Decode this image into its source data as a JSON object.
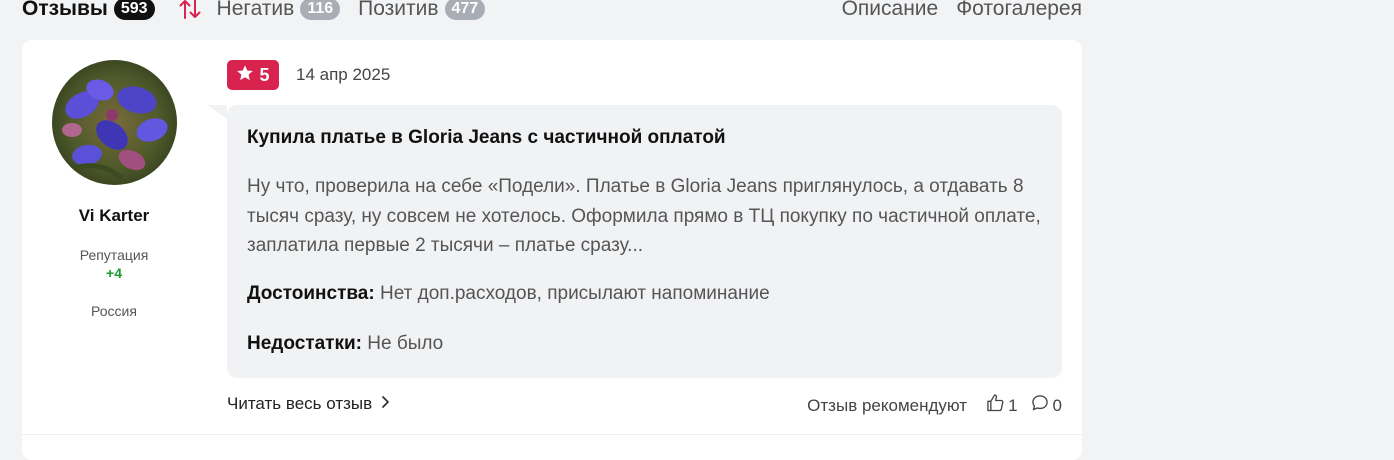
{
  "tabs": {
    "reviews": {
      "label": "Отзывы",
      "count": "593"
    },
    "negative": {
      "label": "Негатив",
      "count": "116"
    },
    "positive": {
      "label": "Позитив",
      "count": "477"
    },
    "description": "Описание",
    "gallery": "Фотогалерея"
  },
  "author": {
    "name": "Vi Karter",
    "reputation_label": "Репутация",
    "reputation_value": "+4",
    "country": "Россия"
  },
  "review": {
    "rating": "5",
    "date": "14 апр 2025",
    "title": "Купила платье в Gloria Jeans с частичной оплатой",
    "text": "Ну что, проверила на себе «Подели». Платье в Gloria Jeans приглянулось, а отдавать 8 тысяч сразу, ну совсем не хотелось. Оформила прямо в ТЦ покупку по частичной оплате, заплатила первые 2 тысячи – платье сразу...",
    "pros_label": "Достоинства:",
    "pros": "Нет доп.расходов, присылают напоминание",
    "cons_label": "Недостатки:",
    "cons": "Не было"
  },
  "footer": {
    "read_more": "Читать весь отзыв",
    "recommend": "Отзыв рекомендуют",
    "likes": "1",
    "comments": "0"
  },
  "colors": {
    "rating_bg": "#d9234f",
    "reputation": "#1a9c2e",
    "sort_icon": "#d9234f"
  },
  "icons": [
    "sort-icon",
    "star-icon",
    "chevron-right-icon",
    "thumbs-up-icon",
    "comment-icon"
  ]
}
